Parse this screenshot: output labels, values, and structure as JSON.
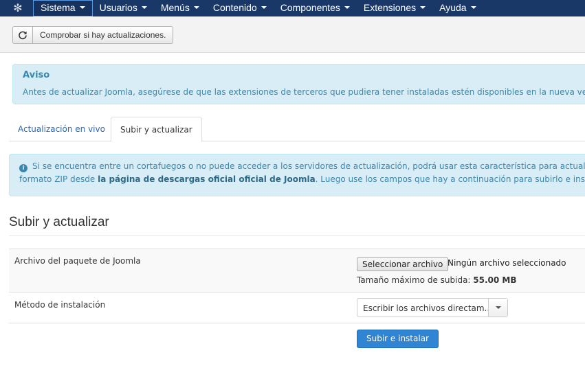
{
  "nav": {
    "logo_icon": "joomla-icon",
    "items": [
      {
        "label": "Sistema"
      },
      {
        "label": "Usuarios"
      },
      {
        "label": "Menús"
      },
      {
        "label": "Contenido"
      },
      {
        "label": "Componentes"
      },
      {
        "label": "Extensiones"
      },
      {
        "label": "Ayuda"
      }
    ]
  },
  "toolbar": {
    "refresh_icon": "refresh-icon",
    "check_label": "Comprobar si hay actualizaciones."
  },
  "aviso": {
    "title": "Aviso",
    "text": "Antes de actualizar Joomla, asegúrese de que las extensiones de terceros que pudiera tener instaladas estén disponibles en la nueva versión"
  },
  "tabs": [
    {
      "label": "Actualización en vivo"
    },
    {
      "label": "Subir y actualizar"
    }
  ],
  "info": {
    "line1": "Si se encuentra entre un cortafuegos o no puede acceder a los servidores de actualización, podrá usar esta característica para actualizar J",
    "line2_pre": "formato ZIP desde ",
    "line2_link": "la página de descargas oficial oficial de Joomla",
    "line2_post": ". Luego use los campos que hay a continuación para subirlo e instalarl"
  },
  "section": {
    "title": "Subir y actualizar"
  },
  "form": {
    "package_label": "Archivo del paquete de Joomla",
    "file_button": "Seleccionar archivo",
    "file_none": "Ningún archivo seleccionado",
    "maxsize_label": "Tamaño máximo de subida: ",
    "maxsize_value": "55.00 MB",
    "method_label": "Método de instalación",
    "method_value": "Escribir los archivos directam...",
    "submit_label": "Subir e instalar"
  },
  "colors": {
    "navbar": "#1a3867",
    "info_bg": "#d9edf7",
    "info_text": "#3a87ad",
    "primary_button": "#2f84d3"
  }
}
